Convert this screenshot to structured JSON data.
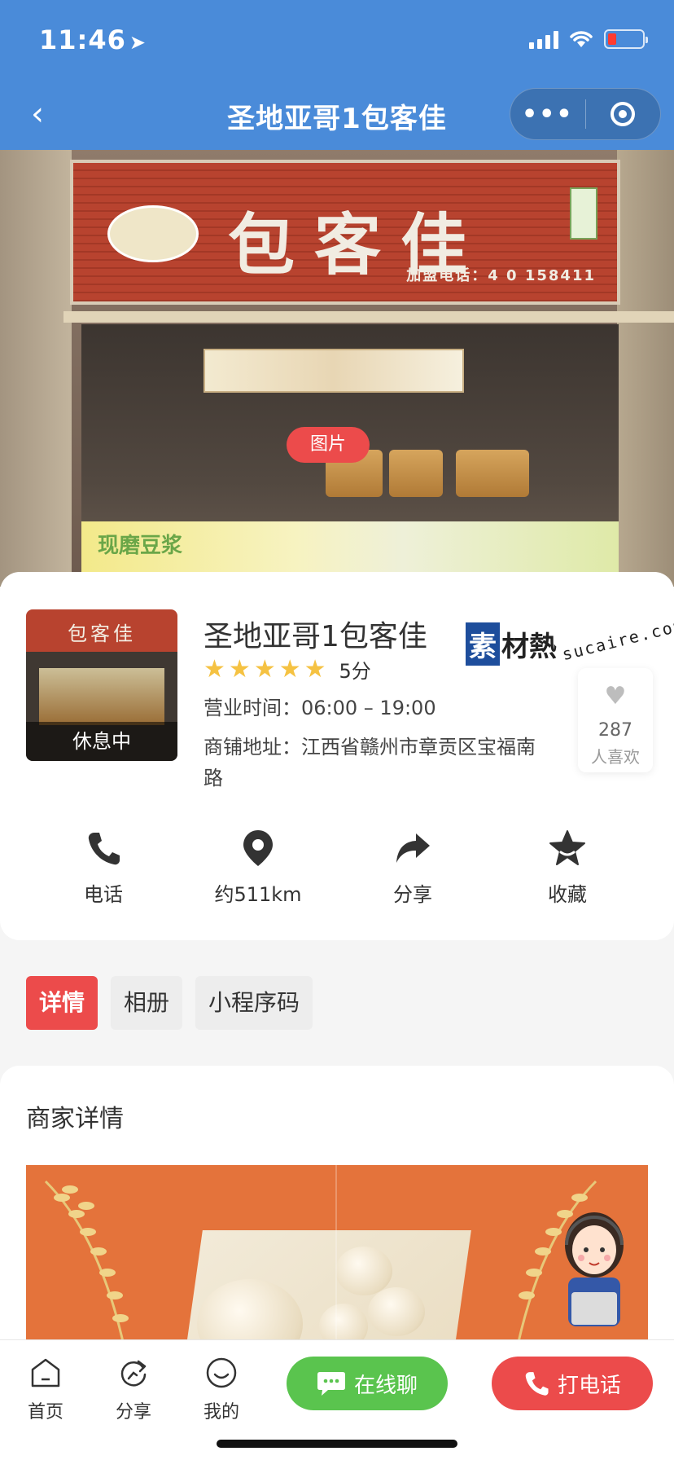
{
  "status_bar": {
    "time": "11:46",
    "location_glyph": "➤"
  },
  "nav": {
    "back_glyph": "‹",
    "title": "圣地亚哥1包客佳",
    "more_glyph": "•••"
  },
  "hero": {
    "sign_text": "包客佳",
    "sign_phone": "加盟电话：4 0 158411",
    "counter_text": "现磨豆浆",
    "tag_label": "图片"
  },
  "shop": {
    "status": "休息中",
    "name": "圣地亚哥1包客佳",
    "rating": 5,
    "score_label": "5分",
    "hours": "营业时间：06:00 – 19:00",
    "address": "商铺地址：江西省赣州市章贡区宝福南路",
    "likes": {
      "count": "287",
      "label": "人喜欢"
    },
    "watermark": {
      "box": "素",
      "rest": "材熱",
      "en": "sucaire.com"
    }
  },
  "actions": [
    {
      "label": "电话",
      "icon": "phone-icon"
    },
    {
      "label": "约511km",
      "icon": "location-pin-icon"
    },
    {
      "label": "分享",
      "icon": "share-arrow-icon"
    },
    {
      "label": "收藏",
      "icon": "star-icon"
    }
  ],
  "tabs": [
    {
      "label": "详情",
      "active": true
    },
    {
      "label": "相册",
      "active": false
    },
    {
      "label": "小程序码",
      "active": false
    }
  ],
  "detail": {
    "title": "商家详情"
  },
  "bottom_bar": {
    "home": "首页",
    "share": "分享",
    "mine": "我的",
    "chat": "在线聊",
    "call": "打电话"
  },
  "colors": {
    "nav_blue": "#4a8bd9",
    "accent_red": "#ec4b4b",
    "chat_green": "#5ac44e",
    "star_yellow": "#f5c242",
    "banner_orange": "#e4733b"
  }
}
